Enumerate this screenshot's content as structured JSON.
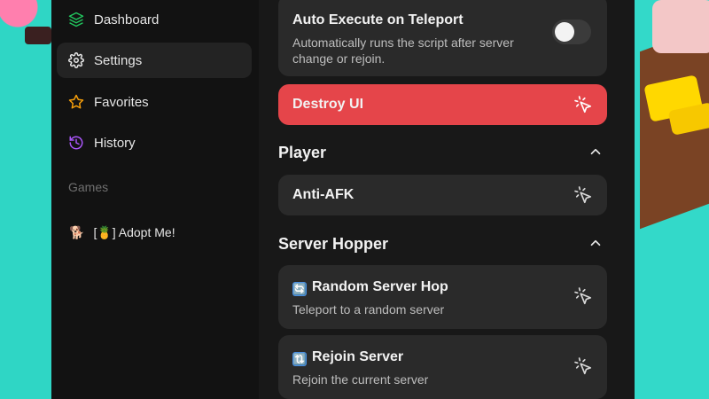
{
  "sidebar": {
    "items": [
      {
        "label": "Dashboard",
        "icon": "layers-icon",
        "color": "#22c55e"
      },
      {
        "label": "Settings",
        "icon": "gear-icon",
        "color": "#e6e6e6",
        "active": true
      },
      {
        "label": "Favorites",
        "icon": "star-icon",
        "color": "#f59e0b"
      },
      {
        "label": "History",
        "icon": "history-icon",
        "color": "#a855f7"
      }
    ],
    "games_label": "Games",
    "game": {
      "label": "[🍍] Adopt Me!",
      "icon": "dog-icon"
    }
  },
  "settings": {
    "auto_execute": {
      "title": "Auto Execute on Teleport",
      "description": "Automatically runs the script after server change or rejoin.",
      "enabled": false
    },
    "destroy_ui": {
      "label": "Destroy UI"
    },
    "player_section": {
      "title": "Player"
    },
    "anti_afk": {
      "label": "Anti-AFK"
    },
    "server_hopper_section": {
      "title": "Server Hopper"
    },
    "random_hop": {
      "title": "Random Server Hop",
      "emoji": "🔄",
      "description": "Teleport to a random server"
    },
    "rejoin": {
      "title": "Rejoin Server",
      "emoji": "🔃",
      "description": "Rejoin the current server"
    }
  },
  "colors": {
    "accent_danger": "#e5454a",
    "card_bg": "#2a2a2a",
    "panel_bg": "#181818",
    "sidebar_bg": "#121212"
  }
}
